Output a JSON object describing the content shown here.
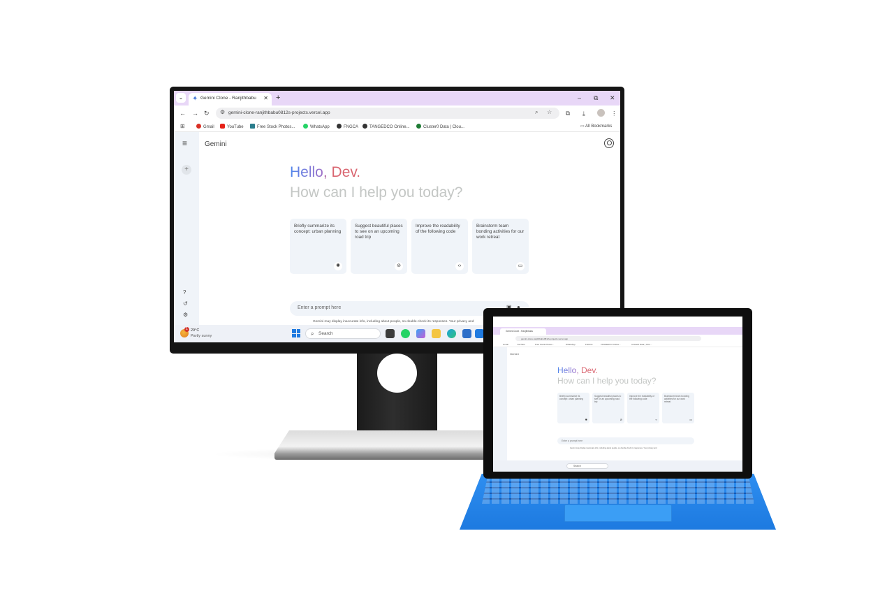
{
  "browser": {
    "tab_title": "Gemini Clone - Ranjithbabu",
    "tab_close": "✕",
    "new_tab": "+",
    "minimize": "–",
    "maximize": "⧉",
    "close": "✕",
    "url": "gemini-clone-ranjithbabu0812s-projects.vercel.app",
    "bookmarks": [
      "Gmail",
      "YouTube",
      "Free Stock Photos...",
      "WhatsApp",
      "FNGCA",
      "TANGEDCO Online...",
      "Cluster0 Data | Clou..."
    ],
    "all_bookmarks": "All Bookmarks"
  },
  "app": {
    "name": "Gemini",
    "greeting": "Hello, Dev.",
    "subheading": "How can I help you today?",
    "cards": [
      {
        "text": "Briefly summarize its concept: urban planning",
        "icon": "lightbulb-icon",
        "glyph": "💡"
      },
      {
        "text": "Suggest beautiful places to see on an upcoming road trip",
        "icon": "compass-icon",
        "glyph": "🧭"
      },
      {
        "text": "Improve the readability of the following code",
        "icon": "code-icon",
        "glyph": "‹›"
      },
      {
        "text": "Brainstorm team bonding activities for our work retreat",
        "icon": "message-icon",
        "glyph": "▭"
      }
    ],
    "prompt_placeholder": "Enter a prompt here",
    "disclaimer": "Gemini may display inaccurate info, including about people, so double-check its responses. Your privacy and"
  },
  "taskbar": {
    "weather_temp": "29°C",
    "weather_desc": "Partly sunny",
    "weather_badge": "1",
    "search_label": "Search"
  },
  "laptop": {
    "tab_title": "Gemini Clone - Ranjithbabu",
    "app_name": "Gemini",
    "greeting": "Hello, Dev.",
    "subheading": "How can I help you today?",
    "cards": [
      "Briefly summarize its concept: urban planning",
      "Suggest beautiful places to see on an upcoming road trip",
      "Improve the readability of the following code",
      "Brainstorm team bonding activities for our work retreat"
    ],
    "prompt_placeholder": "Enter a prompt here",
    "search_label": "Search"
  },
  "colors": {
    "tab_strip": "#e8d7f7",
    "sidebar": "#f0f4f9",
    "greeting_blue": "#4f86ec",
    "greeting_red": "#d96570",
    "keyboard_blue": "#1d7ae0"
  }
}
